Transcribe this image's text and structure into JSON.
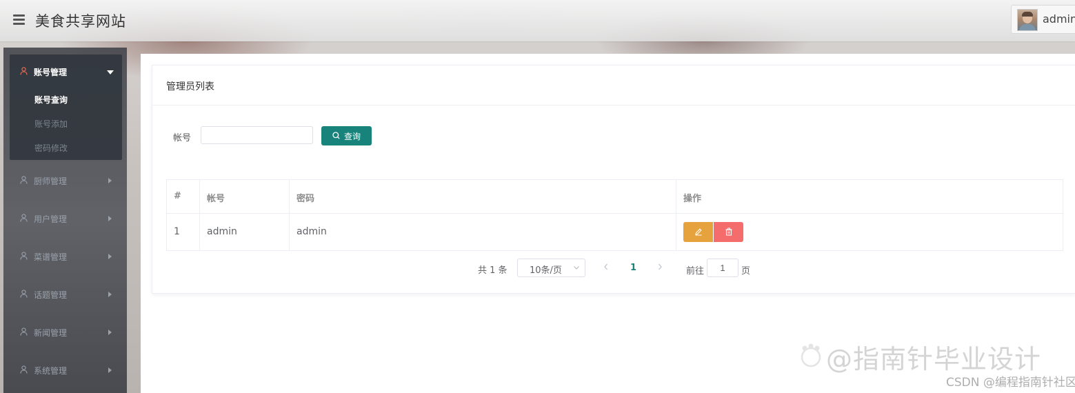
{
  "header": {
    "site_title": "美食共享网站",
    "user_name": "admin"
  },
  "sidebar": {
    "groups": [
      {
        "label": "账号管理",
        "open": true,
        "items": [
          {
            "label": "账号查询",
            "active": true
          },
          {
            "label": "账号添加",
            "active": false
          },
          {
            "label": "密码修改",
            "active": false
          }
        ]
      },
      {
        "label": "厨师管理"
      },
      {
        "label": "用户管理"
      },
      {
        "label": "菜谱管理"
      },
      {
        "label": "话题管理"
      },
      {
        "label": "新闻管理"
      },
      {
        "label": "系统管理"
      }
    ]
  },
  "card": {
    "title": "管理员列表",
    "search": {
      "label": "帐号",
      "value": "",
      "button_label": "查询"
    },
    "table": {
      "headers": [
        "#",
        "帐号",
        "密码",
        "操作"
      ],
      "rows": [
        {
          "index": "1",
          "account": "admin",
          "password": "admin"
        }
      ]
    },
    "pagination": {
      "total_text": "共 1 条",
      "page_size": "10条/页",
      "current_page": "1",
      "goto_label": "前往",
      "goto_value": "1",
      "page_label": "页"
    }
  },
  "watermark": {
    "main": "@指南针毕业设计",
    "csdn": "CSDN @编程指南针社区"
  },
  "colors": {
    "primary": "#18837a",
    "edit": "#e6a23c",
    "delete": "#f56c6c",
    "sidebar_bg": "#3c3f46"
  }
}
